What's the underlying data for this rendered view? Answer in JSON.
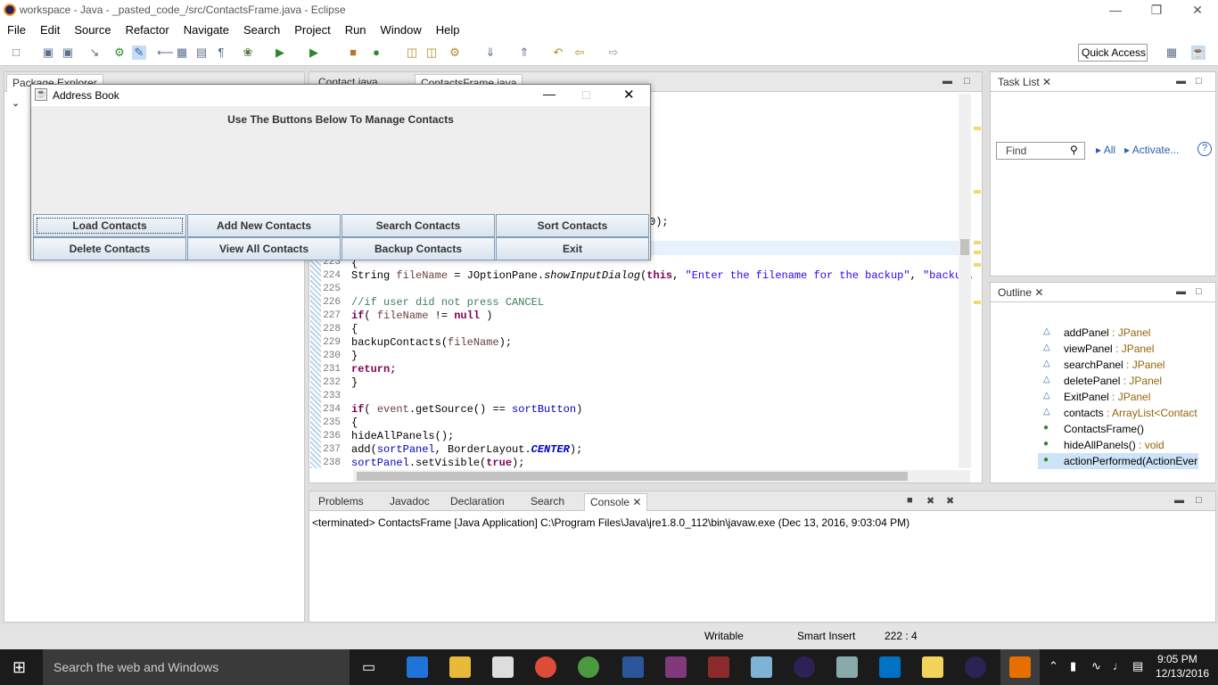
{
  "window": {
    "title": "workspace - Java - _pasted_code_/src/ContactsFrame.java - Eclipse"
  },
  "menu": [
    "File",
    "Edit",
    "Source",
    "Refactor",
    "Navigate",
    "Search",
    "Project",
    "Run",
    "Window",
    "Help"
  ],
  "quick_access": "Quick Access",
  "package_explorer": {
    "tab": "Package Explorer"
  },
  "editor": {
    "tabs": [
      "Contact.java",
      "ContactsFrame.java"
    ],
    "partial_line": "0);",
    "lines": [
      {
        "n": "223",
        "text": "{"
      },
      {
        "n": "224",
        "text": "String fileName = JOptionPane.showInputDialog(this, \"Enter the filename for the backup\", \"backup."
      },
      {
        "n": "225",
        "text": ""
      },
      {
        "n": "226",
        "text": "//if user did not press CANCEL"
      },
      {
        "n": "227",
        "text": "if( fileName != null )"
      },
      {
        "n": "228",
        "text": "{"
      },
      {
        "n": "229",
        "text": "backupContacts(fileName);"
      },
      {
        "n": "230",
        "text": "}"
      },
      {
        "n": "231",
        "text": "return;"
      },
      {
        "n": "232",
        "text": "}"
      },
      {
        "n": "233",
        "text": ""
      },
      {
        "n": "234",
        "text": "if( event.getSource() == sortButton)"
      },
      {
        "n": "235",
        "text": "{"
      },
      {
        "n": "236",
        "text": "hideAllPanels();"
      },
      {
        "n": "237",
        "text": "add(sortPanel, BorderLayout.CENTER);"
      },
      {
        "n": "238",
        "text": "sortPanel.setVisible(true);"
      }
    ]
  },
  "task_list": {
    "title": "Task List",
    "find_placeholder": "Find",
    "all": "All",
    "activate": "Activate..."
  },
  "outline": {
    "title": "Outline",
    "items": [
      {
        "name": "addPanel",
        "type": " : JPanel"
      },
      {
        "name": "viewPanel",
        "type": " : JPanel"
      },
      {
        "name": "searchPanel",
        "type": " : JPanel"
      },
      {
        "name": "deletePanel",
        "type": " : JPanel"
      },
      {
        "name": "ExitPanel",
        "type": " : JPanel"
      },
      {
        "name": "contacts",
        "type": " : ArrayList<Contact"
      },
      {
        "name": "ContactsFrame()",
        "type": ""
      },
      {
        "name": "hideAllPanels()",
        "type": " : void"
      },
      {
        "name": "actionPerformed(ActionEver",
        "type": ""
      }
    ]
  },
  "console": {
    "tabs": [
      "Problems",
      "Javadoc",
      "Declaration",
      "Search",
      "Console"
    ],
    "output": "<terminated> ContactsFrame [Java Application] C:\\Program Files\\Java\\jre1.8.0_112\\bin\\javaw.exe (Dec 13, 2016, 9:03:04 PM)"
  },
  "status": {
    "writable": "Writable",
    "insert": "Smart Insert",
    "position": "222 : 4"
  },
  "taskbar": {
    "search": "Search the web and Windows",
    "time": "9:05 PM",
    "date": "12/13/2016"
  },
  "dialog": {
    "title": "Address Book",
    "heading": "Use The Buttons Below To Manage Contacts",
    "buttons": [
      "Load Contacts",
      "Add New Contacts",
      "Search Contacts",
      "Sort Contacts",
      "Delete Contacts",
      "View All Contacts",
      "Backup Contacts",
      "Exit"
    ]
  }
}
